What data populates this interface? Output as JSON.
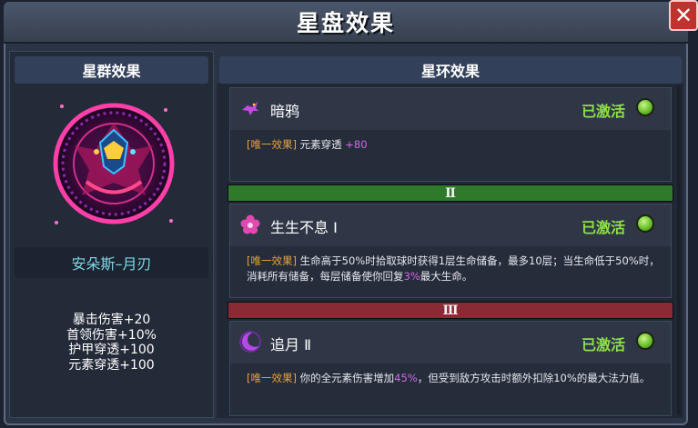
{
  "window": {
    "title": "星盘效果",
    "close_label": "✕"
  },
  "left": {
    "header": "星群效果",
    "name": "安朵斯–月刃",
    "stats": [
      "暴击伤害+20",
      "首领伤害+10%",
      "护甲穿透+100",
      "元素穿透+100"
    ]
  },
  "right": {
    "header": "星环效果",
    "tiers": [
      "Ⅱ",
      "Ⅲ"
    ],
    "cards": [
      {
        "name": "暗鸦",
        "status": "已激活",
        "tag": "[唯一效果]",
        "desc_a": "元素穿透 ",
        "desc_hl": "+80",
        "desc_b": ""
      },
      {
        "name": "生生不息 Ⅰ",
        "status": "已激活",
        "tag": "[唯一效果]",
        "desc_a": "生命高于50%时拾取球时获得1层生命储备，最多10层；当生命低于50%时，消耗所有储备，每层储备使你回复",
        "desc_hl": "3%",
        "desc_b": "最大生命。"
      },
      {
        "name": "追月 Ⅱ",
        "status": "已激活",
        "tag": "[唯一效果]",
        "desc_a": "你的全元素伤害增加",
        "desc_hl": "45%",
        "desc_b": "，但受到敌方攻击时额外扣除10%的最大法力值。"
      }
    ]
  },
  "colors": {
    "active": "#8fe04a",
    "tier2": "#2e7a2a",
    "tier3": "#8a2a34",
    "highlight": "#d06ae8",
    "tag": "#e8a040"
  },
  "icons": [
    "raven-icon",
    "flower-icon",
    "crescent-moon-icon",
    "status-dot-icon",
    "close-icon",
    "constellation-emblem"
  ]
}
